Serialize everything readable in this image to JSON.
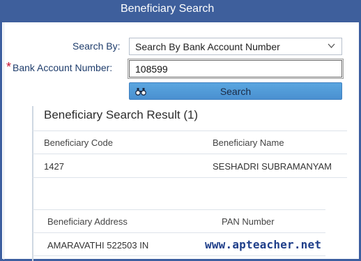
{
  "window": {
    "title": "Beneficiary Search"
  },
  "form": {
    "search_by_label": "Search By:",
    "search_by_value": "Search By Bank Account Number",
    "required_mark": "*",
    "bank_account_label": "Bank Account Number:",
    "bank_account_value": "108599",
    "search_button_label": "Search"
  },
  "results": {
    "title": "Beneficiary Search Result (1)",
    "table1": {
      "headers": [
        "Beneficiary Code",
        "Beneficiary Name"
      ],
      "rows": [
        [
          "1427",
          "SESHADRI SUBRAMANYAM"
        ]
      ]
    },
    "table2": {
      "headers": [
        "Beneficiary Address",
        "PAN Number"
      ],
      "rows": [
        [
          "AMARAVATHI 522503 IN",
          ""
        ]
      ]
    }
  },
  "watermark": "www.apteacher.net",
  "icons": {
    "select_chevron": "chevron-down-icon",
    "search": "binoculars-icon"
  },
  "colors": {
    "title_bar": "#3e5f9c",
    "button": "#4a90d0",
    "label": "#1f3d6c",
    "required": "#c8102e"
  }
}
